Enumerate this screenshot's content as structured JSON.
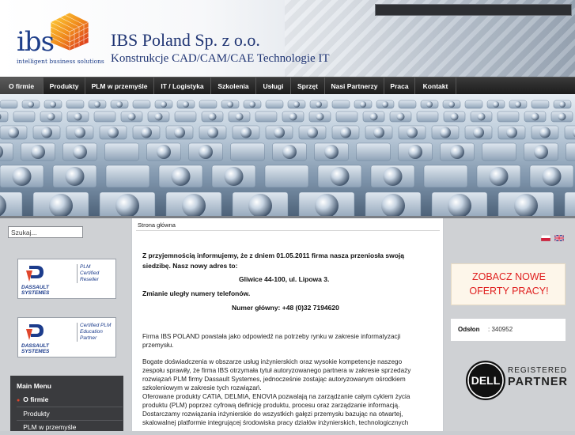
{
  "header": {
    "logo_text": "ibs",
    "logo_tagline": "intelligent business solutions",
    "company_name": "IBS Poland Sp. z o.o.",
    "subtitle": "Konstrukcje CAD/CAM/CAE  Technologie IT"
  },
  "nav": {
    "items": [
      {
        "label": "O firmie",
        "active": true
      },
      {
        "label": "Produkty"
      },
      {
        "label": "PLM w przemyśle"
      },
      {
        "label": "IT / Logistyka"
      },
      {
        "label": "Szkolenia"
      },
      {
        "label": "Usługi"
      },
      {
        "label": "Sprzęt"
      },
      {
        "label": "Nasi Partnerzy"
      },
      {
        "label": "Praca"
      },
      {
        "label": "Kontakt"
      }
    ]
  },
  "left": {
    "search_value": "Szukaj...",
    "badges": [
      {
        "brand": "DASSAULT SYSTEMES",
        "lines": [
          "PLM",
          "Certified",
          "Reseller"
        ]
      },
      {
        "brand": "DASSAULT SYSTEMES",
        "lines": [
          "Certified PLM",
          "Education",
          "Partner"
        ]
      }
    ],
    "main_menu": {
      "title": "Main Menu",
      "items": [
        "O firmie",
        "Produkty",
        "PLM w przemyśle"
      ]
    }
  },
  "content": {
    "breadcrumb": "Strona główna",
    "notice_line1": "Z przyjemnością informujemy, że z dniem 01.05.2011 firma nasza przeniosła swoją",
    "notice_line2": "siedzibę. Nasz nowy adres to:",
    "address": "Gliwice 44-100, ul. Lipowa 3.",
    "phones_changed": "Zmianie uległy numery telefonów.",
    "main_number": "Numer główny: +48 (0)32 7194620",
    "paragraph1": [
      "Firma IBS POLAND powstała jako odpowiedź na potrzeby rynku w zakresie informatyzacji",
      "przemysłu."
    ],
    "paragraph2": [
      "Bogate doświadczenia w obszarze usług inżynierskich oraz wysokie kompetencje naszego",
      "zespołu sprawiły, że firma IBS otrzymała tytuł autoryzowanego partnera w zakresie sprzedaży",
      "rozwiązań PLM firmy Dassault Systemes, jednocześnie zostając autoryzowanym ośrodkiem",
      "szkoleniowym w zakresie tych rozwiązań.",
      "Oferowane produkty CATIA, DELMIA, ENOVIA pozwalają na zarządzanie całym cyklem życia",
      "produktu (PLM) poprzez cyfrową definicję produktu, procesu oraz zarządzanie informacją.",
      "Dostarczamy rozwiązania inżynierskie do wszystkich gałęzi przemysłu bazując na otwartej,",
      "skalowalnej platformie integrującej środowiska pracy działów inżynierskich, technologicznych"
    ]
  },
  "right": {
    "jobs_line1": "ZOBACZ NOWE",
    "jobs_line2": "OFERTY PRACY!",
    "visits_label": "Odsłon",
    "visits_value": ": 340952",
    "dell_logo": "DELL",
    "registered": "REGISTERED",
    "partner": "PARTNER"
  },
  "colors": {
    "brand_blue": "#1f3473",
    "nav_bg": "#1b1b1b",
    "jobs_red": "#e02020",
    "accent_orange": "#e0462c"
  }
}
